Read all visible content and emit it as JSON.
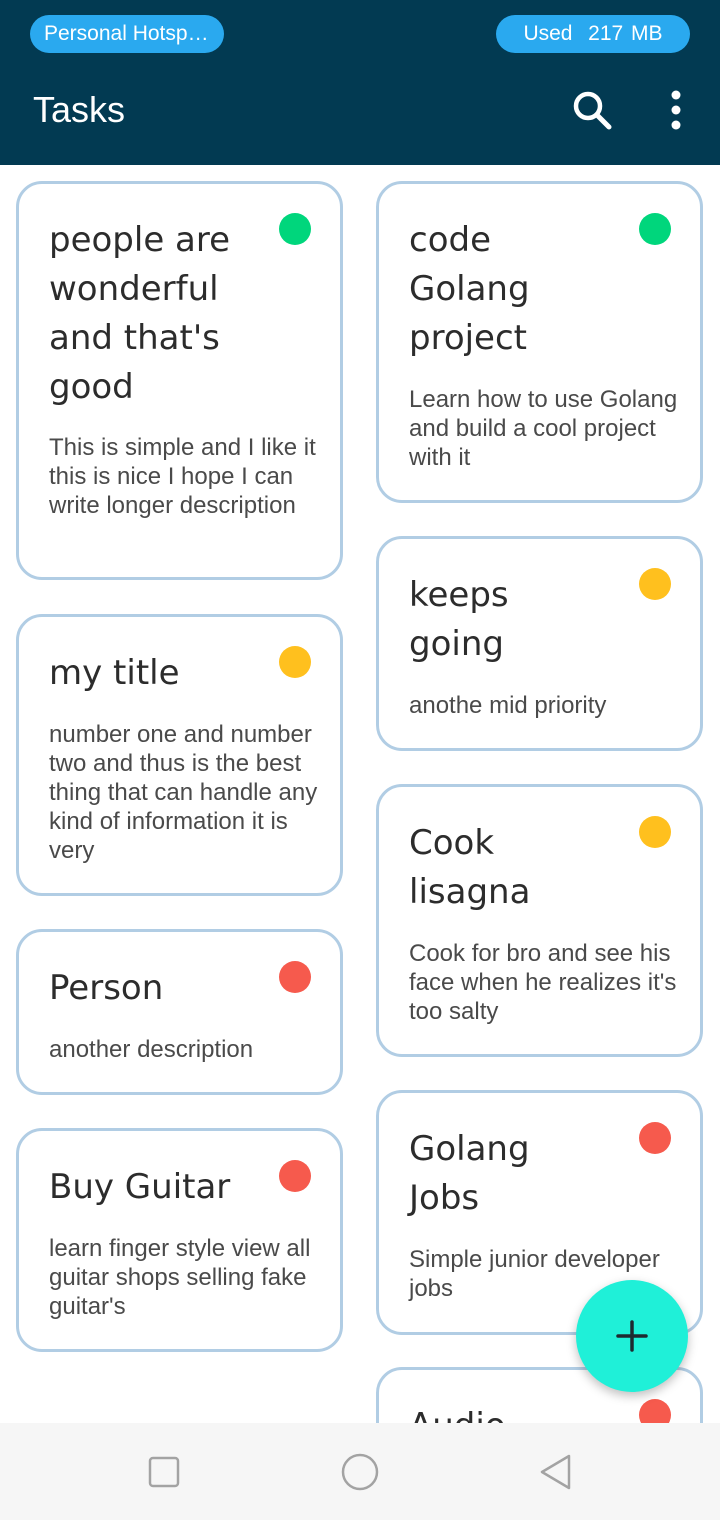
{
  "status_bar": {
    "hotspot_label": "Personal Hotspo…",
    "data_usage_label": "Used  217 MB",
    "pill_color": "#2aa9ef"
  },
  "app_bar": {
    "title": "Tasks",
    "background": "#023a52",
    "search_icon": "search-icon",
    "menu_icon": "more-vert-icon"
  },
  "priority_colors": {
    "low": "#00d67c",
    "mid": "#ffc01e",
    "high": "#f65a4d"
  },
  "columns": [
    {
      "cards": [
        {
          "title": "people are wonderful and that's good",
          "description": "This is simple and I like it this is nice I hope I can write longer description",
          "priority": "low"
        },
        {
          "title": "my title",
          "description": "number one and number two and thus is the best thing that can handle any kind of information it is very",
          "priority": "mid"
        },
        {
          "title": "Person",
          "description": "another description",
          "priority": "high"
        },
        {
          "title": "Buy Guitar",
          "description": "learn finger style view all guitar shops selling fake guitar's",
          "priority": "high"
        }
      ]
    },
    {
      "cards": [
        {
          "title": "code Golang project",
          "description": "Learn how to use Golang and build a cool project with it",
          "priority": "low"
        },
        {
          "title": "keeps going",
          "description": "anothe mid priority",
          "priority": "mid"
        },
        {
          "title": "Cook lisagna",
          "description": "Cook for bro and see his face when he realizes it's too salty",
          "priority": "mid"
        },
        {
          "title": "Golang Jobs",
          "description": "Simple junior developer jobs",
          "priority": "high"
        },
        {
          "title": "Audio",
          "description": "",
          "priority": "high"
        }
      ]
    }
  ],
  "fab": {
    "icon": "plus-icon",
    "color": "#1ff0d8"
  },
  "nav_bar": {
    "icons": [
      "recents-square-icon",
      "home-circle-icon",
      "back-triangle-icon"
    ]
  }
}
